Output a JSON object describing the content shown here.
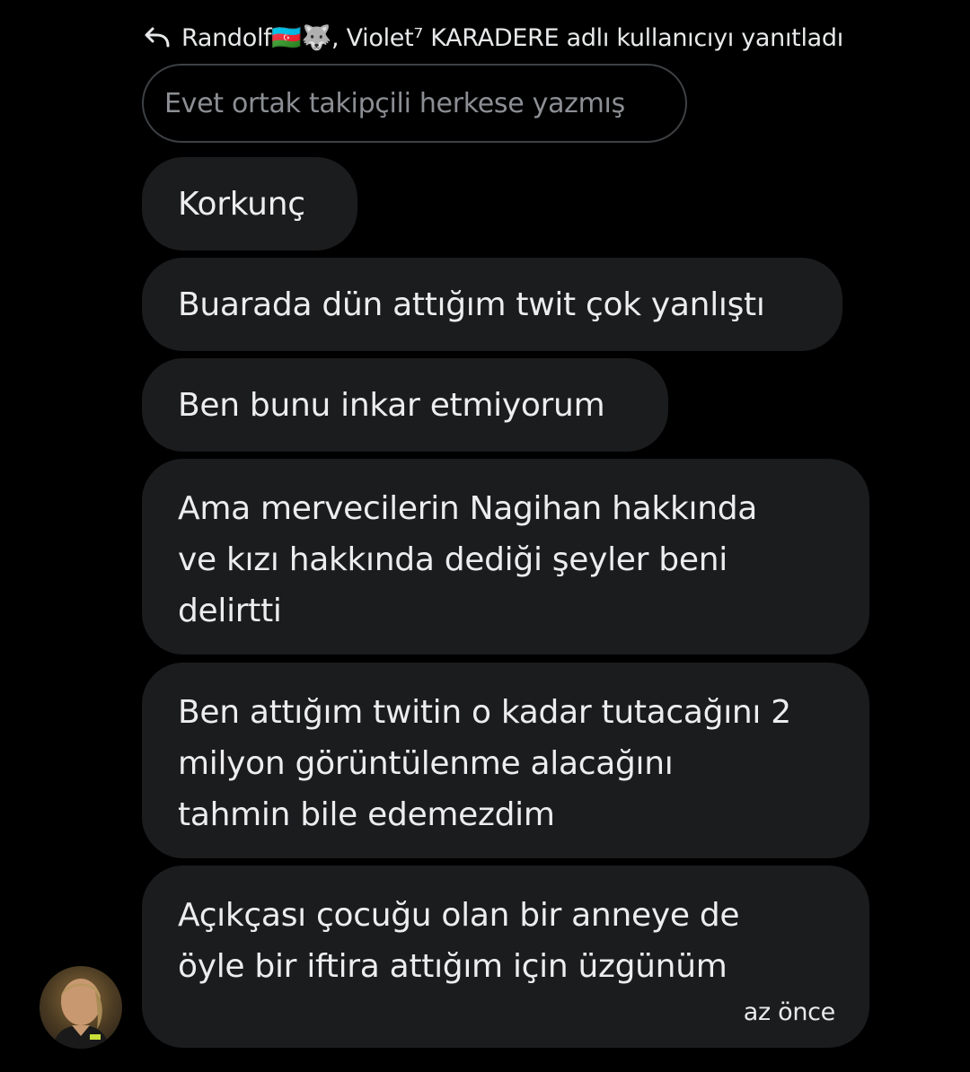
{
  "reply": {
    "icon": "reply-arrow-icon",
    "text": "Randolf🇦🇿🐺, Violet⁷ KARADERE adlı kullanıcıyı yanıtladı"
  },
  "quoted_message": "Evet ortak takipçili herkese yazmış",
  "messages": [
    {
      "lines": [
        "Korkunç"
      ]
    },
    {
      "lines": [
        "Buarada dün attığım twit çok yanlıştı"
      ]
    },
    {
      "lines": [
        "Ben bunu inkar etmiyorum"
      ]
    },
    {
      "lines": [
        "Ama mervecilerin Nagihan hakkında",
        "ve kızı hakkında dediği şeyler beni",
        "delirtti"
      ]
    },
    {
      "lines": [
        "Ben attığım twitin o kadar tutacağını 2",
        "milyon görüntülenme alacağını",
        "tahmin bile edemezdim"
      ]
    },
    {
      "lines": [
        "Açıkçası çocuğu olan bir anneye de",
        "öyle bir iftira attığım için üzgünüm"
      ]
    }
  ],
  "timestamp": "az önce",
  "avatar": {
    "icon": "user-avatar-icon"
  },
  "colors": {
    "background": "#000000",
    "bubble": "#1b1c1e",
    "text": "#ededee",
    "quoted_border": "#3e4144",
    "quoted_text": "#8b8f94"
  }
}
